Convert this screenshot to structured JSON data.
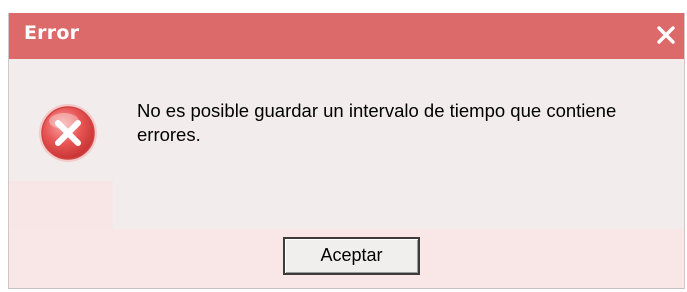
{
  "dialog": {
    "title": "Error",
    "close_icon": "close-icon",
    "status_icon": "error-icon",
    "message": "No es posible guardar un intervalo de tiempo que contiene errores.",
    "ok_label": "Aceptar"
  },
  "colors": {
    "titlebar": "#dc6a6a",
    "body": "#f2ecec",
    "footer": "#f9e7e7",
    "icon_red": "#e34848"
  }
}
